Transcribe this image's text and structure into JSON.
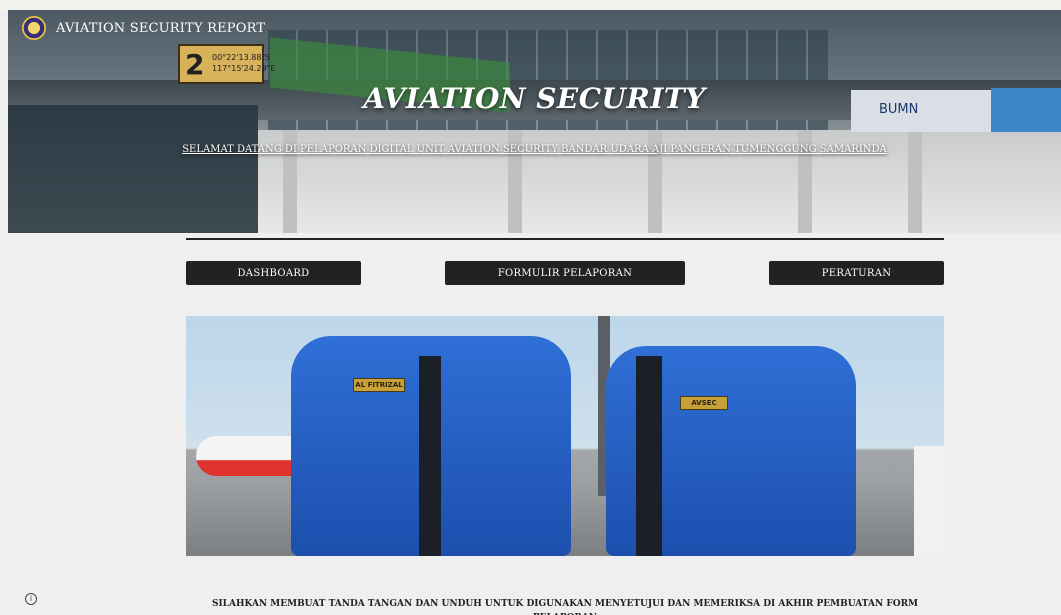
{
  "header": {
    "brand_title": "AVIATION SECURITY REPORT",
    "hero_title": "AVIATION SECURITY",
    "hero_subtitle": "SELAMAT DATANG DI PELAPORAN DIGITAL UNIT AVIATION SECURITY BANDAR UDARA AJI PANGERAN TUMENGGUNG SAMARINDA"
  },
  "hero_image": {
    "gate_number": "2",
    "gate_coord_lat": "00°22'13.88\"S",
    "gate_coord_lon": "117°15'24.29\"E",
    "sign_text": "BUMN"
  },
  "nav": {
    "dashboard": "DASHBOARD",
    "form": "FORMULIR PELAPORAN",
    "rules": "PERATURAN"
  },
  "photo": {
    "badge_left": "AL FITRIZAL",
    "badge_right": "AVSEC"
  },
  "notice": "SILAHKAN MEMBUAT TANDA TANGAN DAN UNDUH UNTUK DIGUNAKAN MENYETUJUI  DAN MEMERIKSA DI AKHIR PEMBUATAN FORM PELAPORAN",
  "icons": {
    "brand": "logo-emblem",
    "info": "info-icon"
  }
}
